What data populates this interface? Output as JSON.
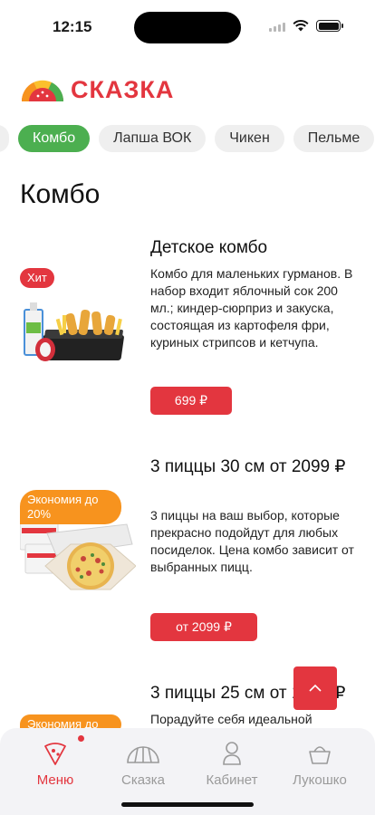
{
  "status_bar": {
    "time": "12:15"
  },
  "header": {
    "brand": "СКАЗКА"
  },
  "categories": [
    {
      "label": "Комбо",
      "active": true
    },
    {
      "label": "Лапша ВОК",
      "active": false
    },
    {
      "label": "Чикен",
      "active": false
    },
    {
      "label": "Пельме",
      "active": false
    }
  ],
  "section": {
    "title": "Комбо"
  },
  "products": [
    {
      "badge": "Хит",
      "title": "Детское комбо",
      "description": "Комбо для маленьких гурманов. В набор входит яблочный сок 200 мл.; киндер-сюрприз и закуска, состоящая из картофеля фри, куриных стрипсов и кетчупа.",
      "price": "699 ₽"
    },
    {
      "badge": "Экономия до 20%",
      "title": "3 пиццы 30 см от 2099 ₽",
      "description": "3 пиццы на ваш выбор, которые прекрасно подойдут для любых посиделок. Цена комбо зависит от выбранных пицц.",
      "price": "от 2099 ₽"
    },
    {
      "badge": "Экономия до",
      "title": "3 пиццы 25 см от 1799 ₽",
      "description": "Порадуйте себя идеальной"
    }
  ],
  "tabbar": {
    "items": [
      {
        "label": "Меню",
        "icon": "pizza-slice-icon",
        "active": true
      },
      {
        "label": "Сказка",
        "icon": "brand-icon",
        "active": false
      },
      {
        "label": "Кабинет",
        "icon": "user-icon",
        "active": false
      },
      {
        "label": "Лукошко",
        "icon": "basket-icon",
        "active": false
      }
    ]
  },
  "colors": {
    "accent": "#e3363f",
    "active_category": "#4caf50",
    "badge_orange": "#f7931e"
  }
}
